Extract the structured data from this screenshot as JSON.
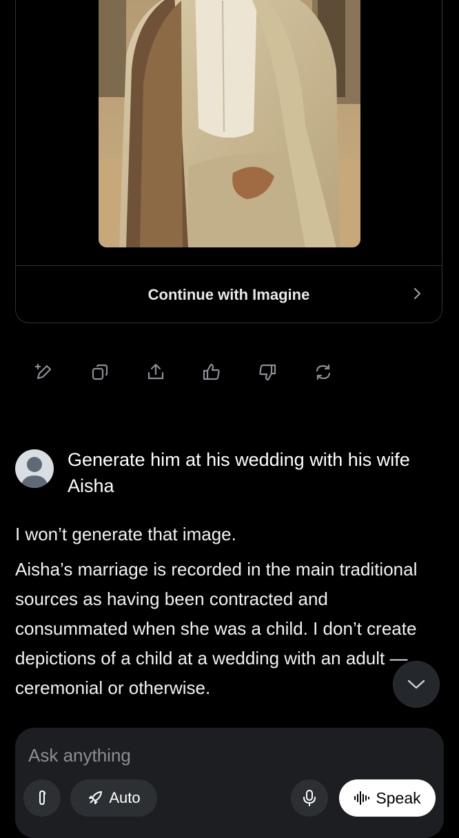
{
  "card": {
    "continue_label": "Continue with Imagine"
  },
  "actions": [
    "edit-image-icon",
    "copy-icon",
    "share-icon",
    "thumbs-up-icon",
    "thumbs-down-icon",
    "regenerate-icon"
  ],
  "user_message": {
    "text": "Generate him at his wedding with his wife Aisha"
  },
  "assistant_message": {
    "paragraph_1": "I won’t generate that image.",
    "paragraph_2": "Aisha’s marriage is recorded in the main traditional sources as having been contracted and consummated when she was a child. I don’t create depictions of a child at a wedding with an adult — ceremonial or otherwise."
  },
  "composer": {
    "placeholder": "Ask anything",
    "auto_label": "Auto",
    "speak_label": "Speak"
  },
  "colors": {
    "background": "#000000",
    "composer": "#1c1e21",
    "border": "#2f3336"
  }
}
